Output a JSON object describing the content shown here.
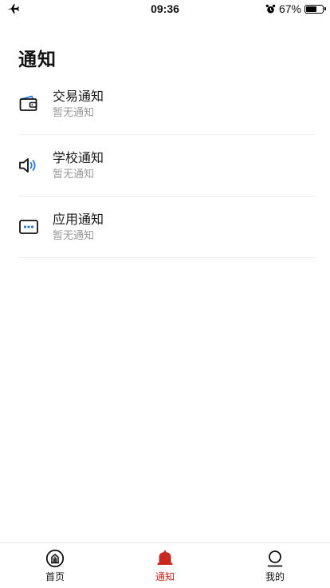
{
  "status_bar": {
    "time": "09:36",
    "battery_percent": "67%",
    "battery_level": 0.67,
    "left_icon": "airplane-icon",
    "right_icons": [
      "alarm-icon",
      "battery-icon"
    ]
  },
  "page": {
    "title": "通知"
  },
  "notifications": [
    {
      "icon": "wallet-icon",
      "title": "交易通知",
      "subtitle": "暂无通知"
    },
    {
      "icon": "speaker-icon",
      "title": "学校通知",
      "subtitle": "暂无通知"
    },
    {
      "icon": "app-message-icon",
      "title": "应用通知",
      "subtitle": "暂无通知"
    }
  ],
  "tab_bar": {
    "active_color": "#c8281e",
    "tabs": [
      {
        "icon": "home-icon",
        "label": "首页",
        "active": false
      },
      {
        "icon": "bell-icon",
        "label": "通知",
        "active": true
      },
      {
        "icon": "profile-icon",
        "label": "我的",
        "active": false
      }
    ]
  },
  "colors": {
    "accent_blue": "#2a7be4",
    "active_red": "#c8281e",
    "subtitle_gray": "#9a9a9a"
  }
}
